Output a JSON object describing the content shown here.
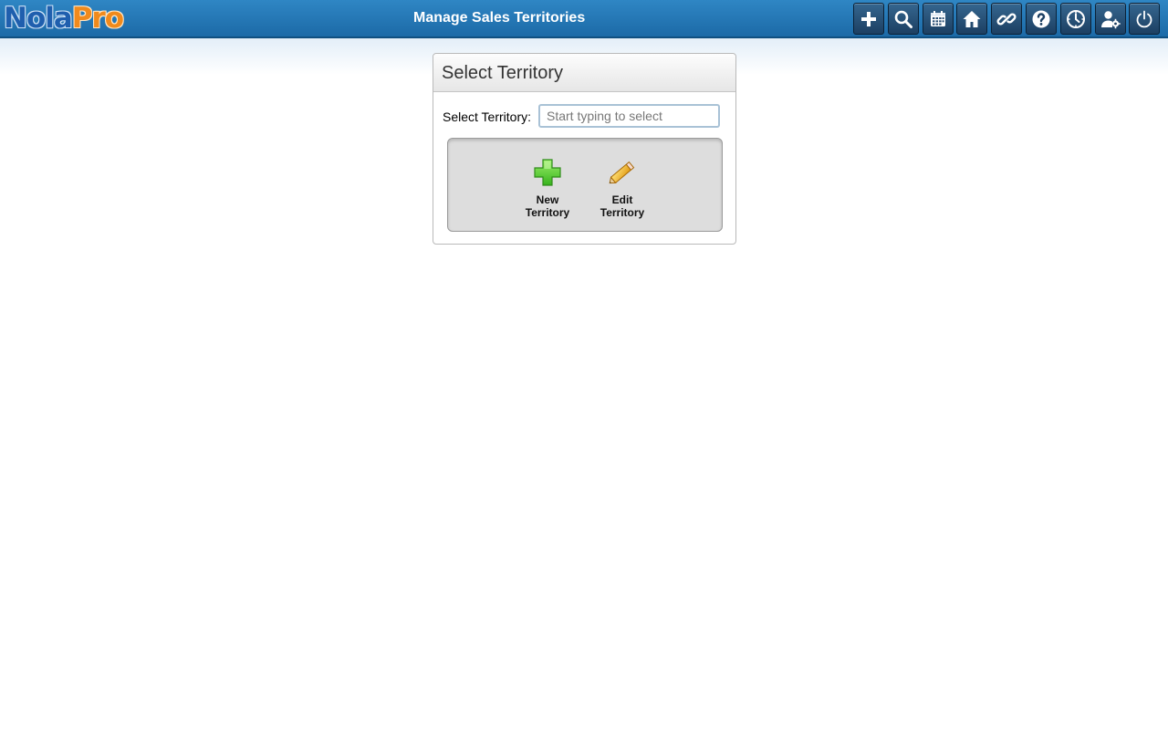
{
  "app": {
    "logo_part1": "Nola",
    "logo_part2": "Pro"
  },
  "header": {
    "title": "Manage Sales Territories"
  },
  "toolbar": {
    "buttons": [
      {
        "icon": "plus-icon"
      },
      {
        "icon": "search-icon"
      },
      {
        "icon": "calendar-icon"
      },
      {
        "icon": "home-icon"
      },
      {
        "icon": "link-icon"
      },
      {
        "icon": "help-icon"
      },
      {
        "icon": "clock-icon"
      },
      {
        "icon": "user-settings-icon"
      },
      {
        "icon": "power-icon"
      }
    ]
  },
  "panel": {
    "title": "Select Territory",
    "field_label": "Select Territory:",
    "field_placeholder": "Start typing to select",
    "field_value": ""
  },
  "actions": {
    "new_line1": "New",
    "new_line2": "Territory",
    "edit_line1": "Edit",
    "edit_line2": "Territory"
  },
  "colors": {
    "header": "#1c6aa7",
    "toolbar_button": "#1c3f62",
    "action_box": "#dddddd"
  }
}
